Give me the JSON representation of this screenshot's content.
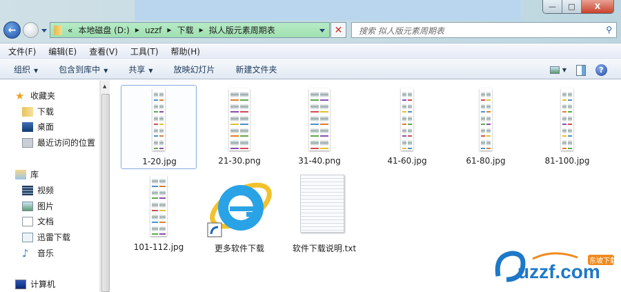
{
  "window": {
    "minimize": "—",
    "maximize": "□",
    "close": "X"
  },
  "nav": {
    "back": "←"
  },
  "address": {
    "prefix": "«",
    "crumbs": [
      "本地磁盘 (D:)",
      "uzzf",
      "下载",
      "拟人版元素周期表"
    ],
    "sep": "▶",
    "clear": "✕"
  },
  "search": {
    "placeholder": "搜索 拟人版元素周期表",
    "icon": "⚲"
  },
  "menu": [
    "文件(F)",
    "编辑(E)",
    "查看(V)",
    "工具(T)",
    "帮助(H)"
  ],
  "toolbar": {
    "organize": "组织",
    "include": "包含到库中",
    "share": "共享",
    "slideshow": "放映幻灯片",
    "new_folder": "新建文件夹",
    "caret": "▼",
    "help": "?"
  },
  "sidebar": {
    "favorites": {
      "label": "收藏夹",
      "items": [
        "下载",
        "桌面",
        "最近访问的位置"
      ]
    },
    "libraries": {
      "label": "库",
      "items": [
        "视频",
        "图片",
        "文档",
        "迅雷下载",
        "音乐"
      ]
    },
    "computer": "计算机",
    "scroll_up": "▲"
  },
  "files": [
    {
      "name": "1-20.jpg",
      "type": "image"
    },
    {
      "name": "21-30.png",
      "type": "image"
    },
    {
      "name": "31-40.png",
      "type": "image"
    },
    {
      "name": "41-60.jpg",
      "type": "image"
    },
    {
      "name": "61-80.jpg",
      "type": "image"
    },
    {
      "name": "81-100.jpg",
      "type": "image"
    },
    {
      "name": "101-112.jpg",
      "type": "image"
    },
    {
      "name": "更多软件下载",
      "type": "shortcut"
    },
    {
      "name": "软件下载说明.txt",
      "type": "text"
    }
  ],
  "watermark": {
    "text": "uzzf.com",
    "tag": "东坡下载"
  }
}
